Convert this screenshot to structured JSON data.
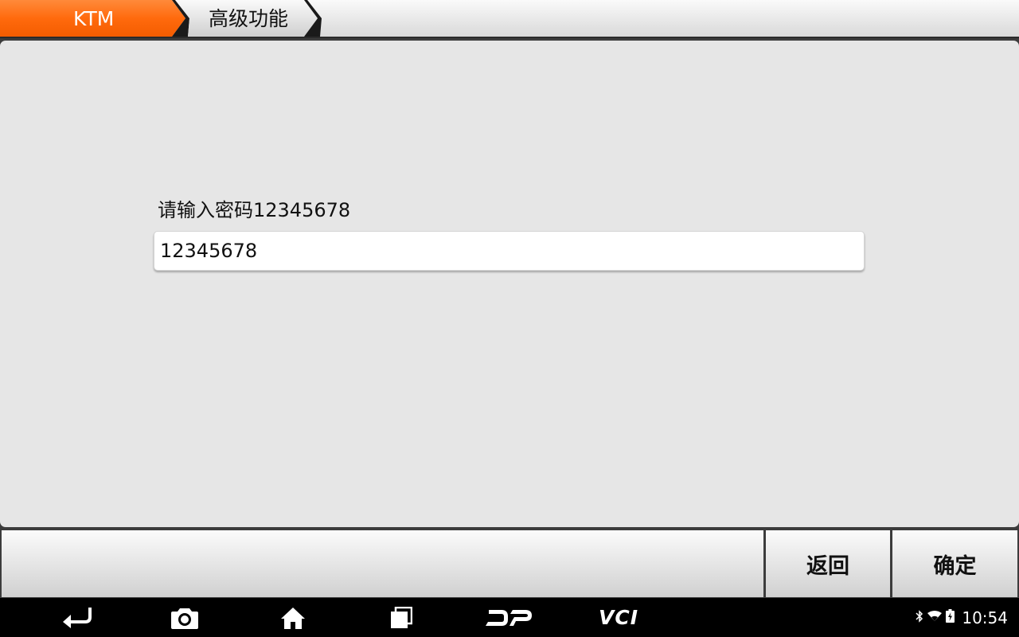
{
  "breadcrumb": {
    "items": [
      "KTM",
      "高级功能"
    ],
    "active_color": "#ff6a0d"
  },
  "main": {
    "prompt": "请输入密码12345678",
    "password_field": {
      "value": "12345678"
    }
  },
  "actions": {
    "back_label": "返回",
    "confirm_label": "确定"
  },
  "navbar": {
    "icons": [
      "back-arrow-icon",
      "camera-icon",
      "home-icon",
      "recent-apps-icon",
      "dp-logo-icon",
      "vci-icon"
    ],
    "vci_label": "VCI"
  },
  "status": {
    "icons": [
      "bluetooth-icon",
      "wifi-icon",
      "battery-icon"
    ],
    "time": "10:54"
  }
}
